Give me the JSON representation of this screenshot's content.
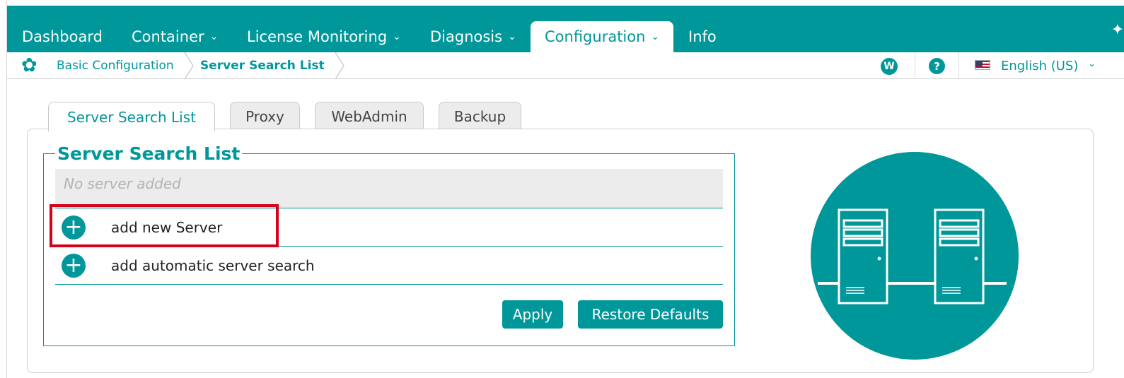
{
  "nav": {
    "items": [
      {
        "label": "Dashboard",
        "has_dropdown": false
      },
      {
        "label": "Container",
        "has_dropdown": true
      },
      {
        "label": "License Monitoring",
        "has_dropdown": true
      },
      {
        "label": "Diagnosis",
        "has_dropdown": true
      },
      {
        "label": "Configuration",
        "has_dropdown": true,
        "active": true
      },
      {
        "label": "Info",
        "has_dropdown": false
      }
    ],
    "chevron": "⌄"
  },
  "breadcrumb": {
    "icon": "gear-icon",
    "items": [
      "Basic Configuration",
      "Server Search List"
    ]
  },
  "toolbar": {
    "webadmin_badge": "W",
    "help_badge": "?",
    "language": "English (US)",
    "language_flag": "us-flag-icon",
    "language_chevron": "⌄"
  },
  "tabs": [
    "Server Search List",
    "Proxy",
    "WebAdmin",
    "Backup"
  ],
  "active_tab": "Server Search List",
  "server_list": {
    "title": "Server Search List",
    "empty_text": "No server added",
    "actions": [
      "add new Server",
      "add automatic server search"
    ],
    "highlighted_action": "add new Server"
  },
  "buttons": {
    "apply": "Apply",
    "restore": "Restore Defaults"
  },
  "colors": {
    "accent": "#00979b",
    "highlight": "#d6001c",
    "row_background": "#ececec"
  }
}
